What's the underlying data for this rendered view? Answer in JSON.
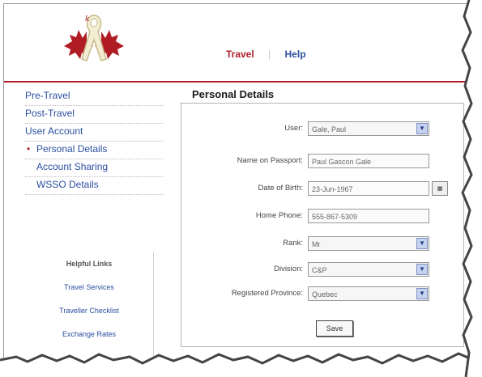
{
  "header": {
    "nav": {
      "travel": "Travel",
      "separator": "|",
      "help": "Help"
    }
  },
  "sidebar": {
    "items": [
      {
        "label": "Pre-Travel"
      },
      {
        "label": "Post-Travel"
      },
      {
        "label": "User Account"
      },
      {
        "label": "Personal Details",
        "active": true
      },
      {
        "label": "Account Sharing"
      },
      {
        "label": "WSSO Details"
      }
    ],
    "helpful_title": "Helpful Links",
    "helpful_links": [
      "Travel Services",
      "Traveller Checklist",
      "Exchange Rates"
    ]
  },
  "main": {
    "title": "Personal Details",
    "fields": {
      "user": {
        "label": "User:",
        "value": "Gale, Paul"
      },
      "passport_name": {
        "label": "Name on Passport:",
        "value": "Paul Gascon Gale"
      },
      "dob": {
        "label": "Date of Birth:",
        "value": "23-Jun-1967"
      },
      "home_phone": {
        "label": "Home Phone:",
        "value": "555-867-5309"
      },
      "rank": {
        "label": "Rank:",
        "value": "Mr"
      },
      "division": {
        "label": "Division:",
        "value": "C&P"
      },
      "province": {
        "label": "Registered Province:",
        "value": "Quebec"
      }
    },
    "save_label": "Save"
  },
  "colors": {
    "brand_red": "#b01c24",
    "link_blue": "#2b4fa0",
    "select_arrow": "#c7d3ee"
  },
  "icons": {
    "logo": "maple-leaf-ribbon-logo",
    "calendar": "calendar-icon",
    "dropdown": "chevron-down-icon"
  }
}
